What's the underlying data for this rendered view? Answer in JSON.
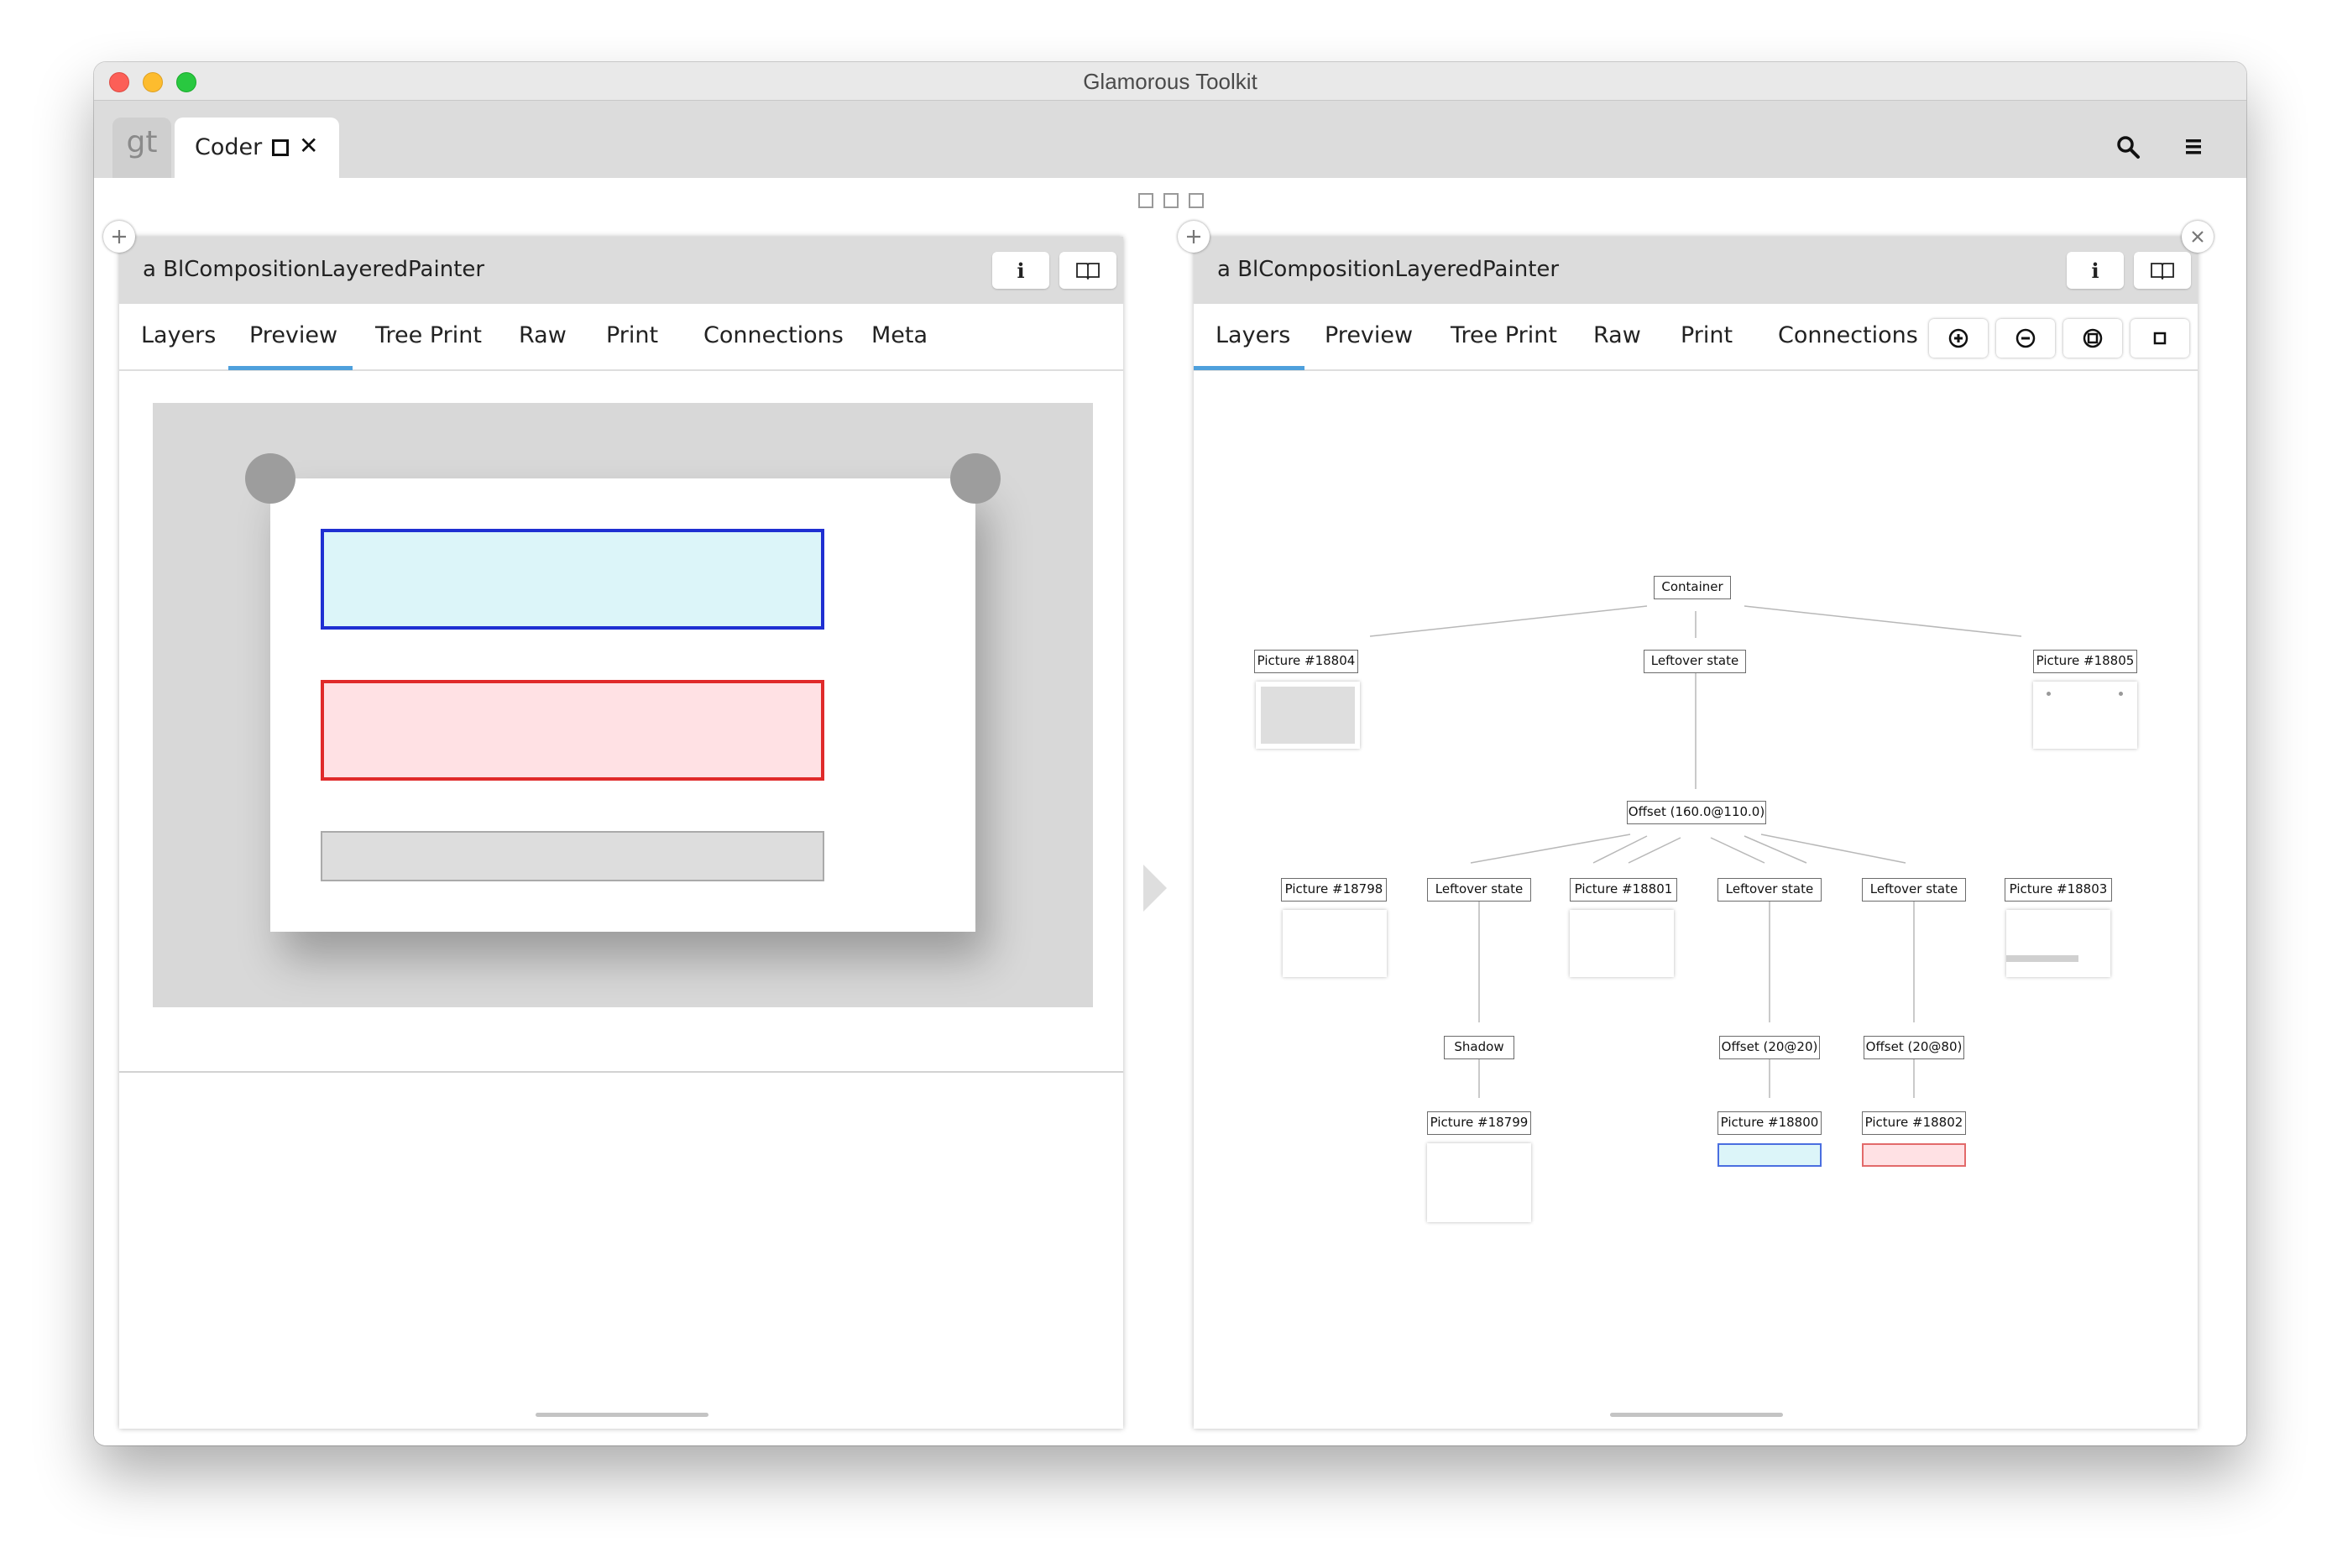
{
  "window": {
    "title": "Glamorous Toolkit"
  },
  "tabbar": {
    "logo_text": "gt",
    "tab_label": "Coder",
    "icons": {
      "maximize": "maximize-square-icon",
      "close": "close-x-icon",
      "search": "search-icon",
      "menu": "hamburger-menu-icon"
    }
  },
  "left_pane": {
    "title": "a BlCompositionLayeredPainter",
    "header_buttons": {
      "info": "i",
      "book": "book-icon"
    },
    "tabs": [
      "Layers",
      "Preview",
      "Tree Print",
      "Raw",
      "Print",
      "Connections",
      "Meta"
    ],
    "active_tab": "Preview"
  },
  "right_pane": {
    "title": "a BlCompositionLayeredPainter",
    "header_buttons": {
      "info": "i",
      "book": "book-icon"
    },
    "tabs": [
      "Layers",
      "Preview",
      "Tree Print",
      "Raw",
      "Print",
      "Connections"
    ],
    "active_tab": "Layers",
    "tools": [
      "zoom-in-icon",
      "zoom-out-icon",
      "fit-icon",
      "actual-size-icon"
    ],
    "tree": {
      "container": "Container",
      "picture_18804": "Picture #18804",
      "leftover_top": "Leftover state",
      "picture_18805": "Picture #18805",
      "offset_main": "Offset (160.0@110.0)",
      "picture_18798": "Picture #18798",
      "leftover_a": "Leftover state",
      "picture_18801": "Picture #18801",
      "leftover_b": "Leftover state",
      "leftover_c": "Leftover state",
      "picture_18803": "Picture #18803",
      "shadow": "Shadow",
      "offset_20_20": "Offset (20@20)",
      "offset_20_80": "Offset (20@80)",
      "picture_18799": "Picture #18799",
      "picture_18800": "Picture #18800",
      "picture_18802": "Picture #18802"
    }
  },
  "colors": {
    "blue_border": "#1f2fd2",
    "blue_fill": "#dcf5f9",
    "red_border": "#e02a2a",
    "red_fill": "#ffe1e4",
    "gray_fill": "#dddddd",
    "tab_accent": "#4ea0dc"
  }
}
